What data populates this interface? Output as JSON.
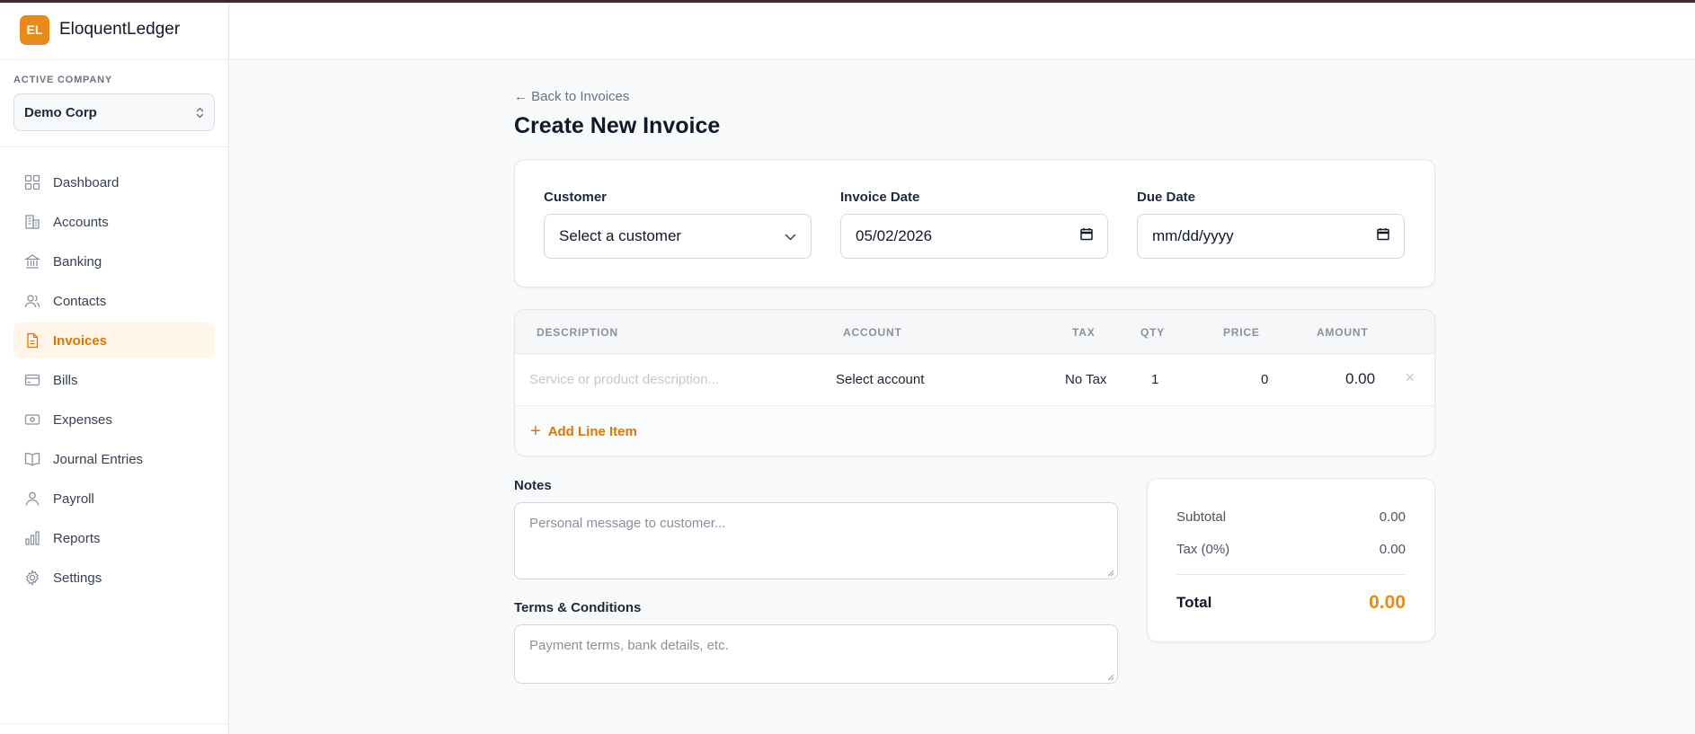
{
  "brand": {
    "logo_text": "EL",
    "name": "EloquentLedger"
  },
  "company": {
    "label": "ACTIVE COMPANY",
    "selected": "Demo Corp"
  },
  "nav": {
    "items": [
      {
        "label": "Dashboard",
        "icon": "dashboard-icon"
      },
      {
        "label": "Accounts",
        "icon": "building-icon"
      },
      {
        "label": "Banking",
        "icon": "bank-icon"
      },
      {
        "label": "Contacts",
        "icon": "users-icon"
      },
      {
        "label": "Invoices",
        "icon": "file-icon",
        "active": true
      },
      {
        "label": "Bills",
        "icon": "credit-card-icon"
      },
      {
        "label": "Expenses",
        "icon": "banknote-icon"
      },
      {
        "label": "Journal Entries",
        "icon": "book-icon"
      },
      {
        "label": "Payroll",
        "icon": "user-icon"
      },
      {
        "label": "Reports",
        "icon": "bar-chart-icon"
      },
      {
        "label": "Settings",
        "icon": "gear-icon"
      }
    ]
  },
  "page": {
    "back_link": "← Back to Invoices",
    "title": "Create New Invoice"
  },
  "fields": {
    "customer": {
      "label": "Customer",
      "value": "Select a customer"
    },
    "invoice_date": {
      "label": "Invoice Date",
      "value": "05/02/2026"
    },
    "due_date": {
      "label": "Due Date",
      "value": "mm/dd/yyyy"
    }
  },
  "lines": {
    "headers": {
      "description": "DESCRIPTION",
      "account": "ACCOUNT",
      "tax": "TAX",
      "qty": "QTY",
      "price": "PRICE",
      "amount": "AMOUNT"
    },
    "rows": [
      {
        "description_placeholder": "Service or product description...",
        "account": "Select account",
        "tax": "No Tax",
        "qty": "1",
        "price": "0",
        "amount": "0.00"
      }
    ],
    "add_label": "Add Line Item"
  },
  "notes": {
    "label": "Notes",
    "placeholder": "Personal message to customer..."
  },
  "terms": {
    "label": "Terms & Conditions",
    "placeholder": "Payment terms, bank details, etc."
  },
  "totals": {
    "subtotal_label": "Subtotal",
    "subtotal": "0.00",
    "tax_label": "Tax (0%)",
    "tax": "0.00",
    "total_label": "Total",
    "total": "0.00"
  },
  "colors": {
    "accent": "#e8891b",
    "active_text": "#d97706",
    "active_bg": "#fff5e8"
  }
}
